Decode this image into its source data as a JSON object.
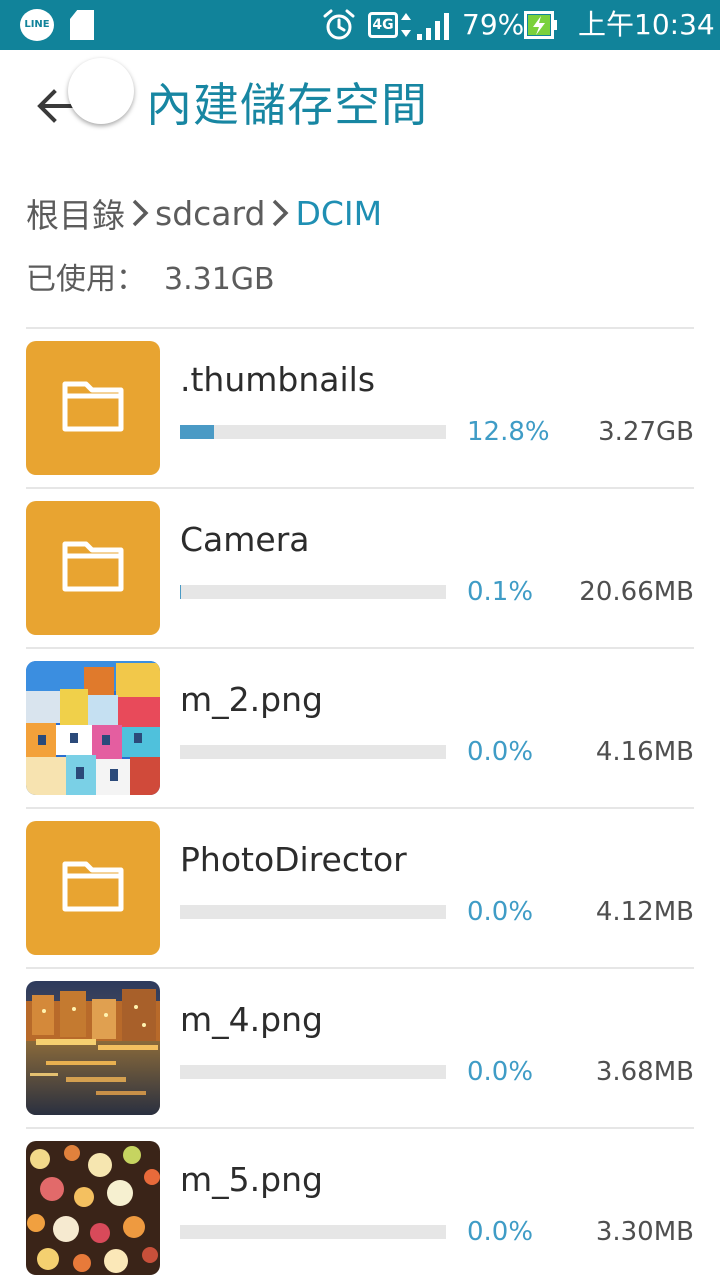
{
  "status_bar": {
    "line_label": "LINE",
    "network": "4G",
    "battery_percent": "79%",
    "time": "上午10:34",
    "icons": [
      "line-icon",
      "sd-card-icon",
      "alarm-icon",
      "signal-icon",
      "battery-charging-icon"
    ]
  },
  "header": {
    "title": "內建儲存空間",
    "back_icon": "arrow-left-icon"
  },
  "breadcrumb": [
    "根目錄",
    "sdcard",
    "DCIM"
  ],
  "usage": {
    "label": "已使用：",
    "value": "3.31GB"
  },
  "colors": {
    "status_bar": "#11839a",
    "title": "#1786a2",
    "folder": "#e8a431",
    "bar_fill": "#4a9ac5",
    "percent_text": "#3f9cc6"
  },
  "items": [
    {
      "name": ".thumbnails",
      "type": "folder",
      "percent": "12.8%",
      "fraction": 0.128,
      "size": "3.27GB"
    },
    {
      "name": "Camera",
      "type": "folder",
      "percent": "0.1%",
      "fraction": 0.001,
      "size": "20.66MB"
    },
    {
      "name": "m_2.png",
      "type": "image",
      "percent": "0.0%",
      "fraction": 0.0,
      "size": "4.16MB"
    },
    {
      "name": "PhotoDirector",
      "type": "folder",
      "percent": "0.0%",
      "fraction": 0.0,
      "size": "4.12MB"
    },
    {
      "name": "m_4.png",
      "type": "image",
      "percent": "0.0%",
      "fraction": 0.0,
      "size": "3.68MB"
    },
    {
      "name": "m_5.png",
      "type": "image",
      "percent": "0.0%",
      "fraction": 0.0,
      "size": "3.30MB"
    }
  ]
}
